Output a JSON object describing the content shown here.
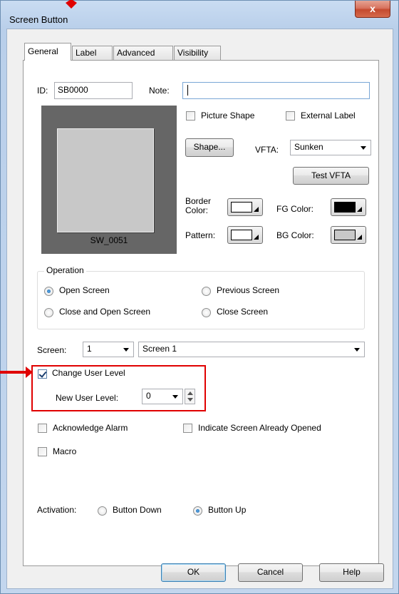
{
  "window": {
    "title": "Screen Button",
    "close_glyph": "x"
  },
  "tabs": [
    "General",
    "Label",
    "Advanced",
    "Visibility"
  ],
  "general": {
    "id_label": "ID:",
    "id_value": "SB0000",
    "note_label": "Note:",
    "note_value": "",
    "preview_label": "SW_0051",
    "picture_shape_label": "Picture Shape",
    "picture_shape_checked": false,
    "external_label_label": "External Label",
    "external_label_checked": false,
    "shape_button": "Shape...",
    "vfta_label": "VFTA:",
    "vfta_value": "Sunken",
    "test_vfta_button": "Test VFTA",
    "border_color_label_1": "Border",
    "border_color_label_2": "Color:",
    "fg_color_label": "FG Color:",
    "pattern_label": "Pattern:",
    "bg_color_label": "BG Color:",
    "colors": {
      "border": "#ffffff",
      "fg": "#000000",
      "pattern": "#ffffff",
      "bg": "#c8c8c8"
    }
  },
  "operation": {
    "title": "Operation",
    "options": [
      "Open Screen",
      "Previous Screen",
      "Close and Open Screen",
      "Close Screen"
    ],
    "selected": "Open Screen"
  },
  "screen": {
    "label": "Screen:",
    "number": "1",
    "name": "Screen 1"
  },
  "user_level": {
    "change_label": "Change User Level",
    "change_checked": true,
    "new_level_label": "New User Level:",
    "new_level_value": "0"
  },
  "options": {
    "ack_alarm": "Acknowledge Alarm",
    "indicate_opened": "Indicate Screen Already Opened",
    "macro": "Macro"
  },
  "activation": {
    "label": "Activation:",
    "options": [
      "Button Down",
      "Button Up"
    ],
    "selected": "Button Up"
  },
  "footer": {
    "ok": "OK",
    "cancel": "Cancel",
    "help": "Help"
  },
  "annotation_color": "#e00000"
}
